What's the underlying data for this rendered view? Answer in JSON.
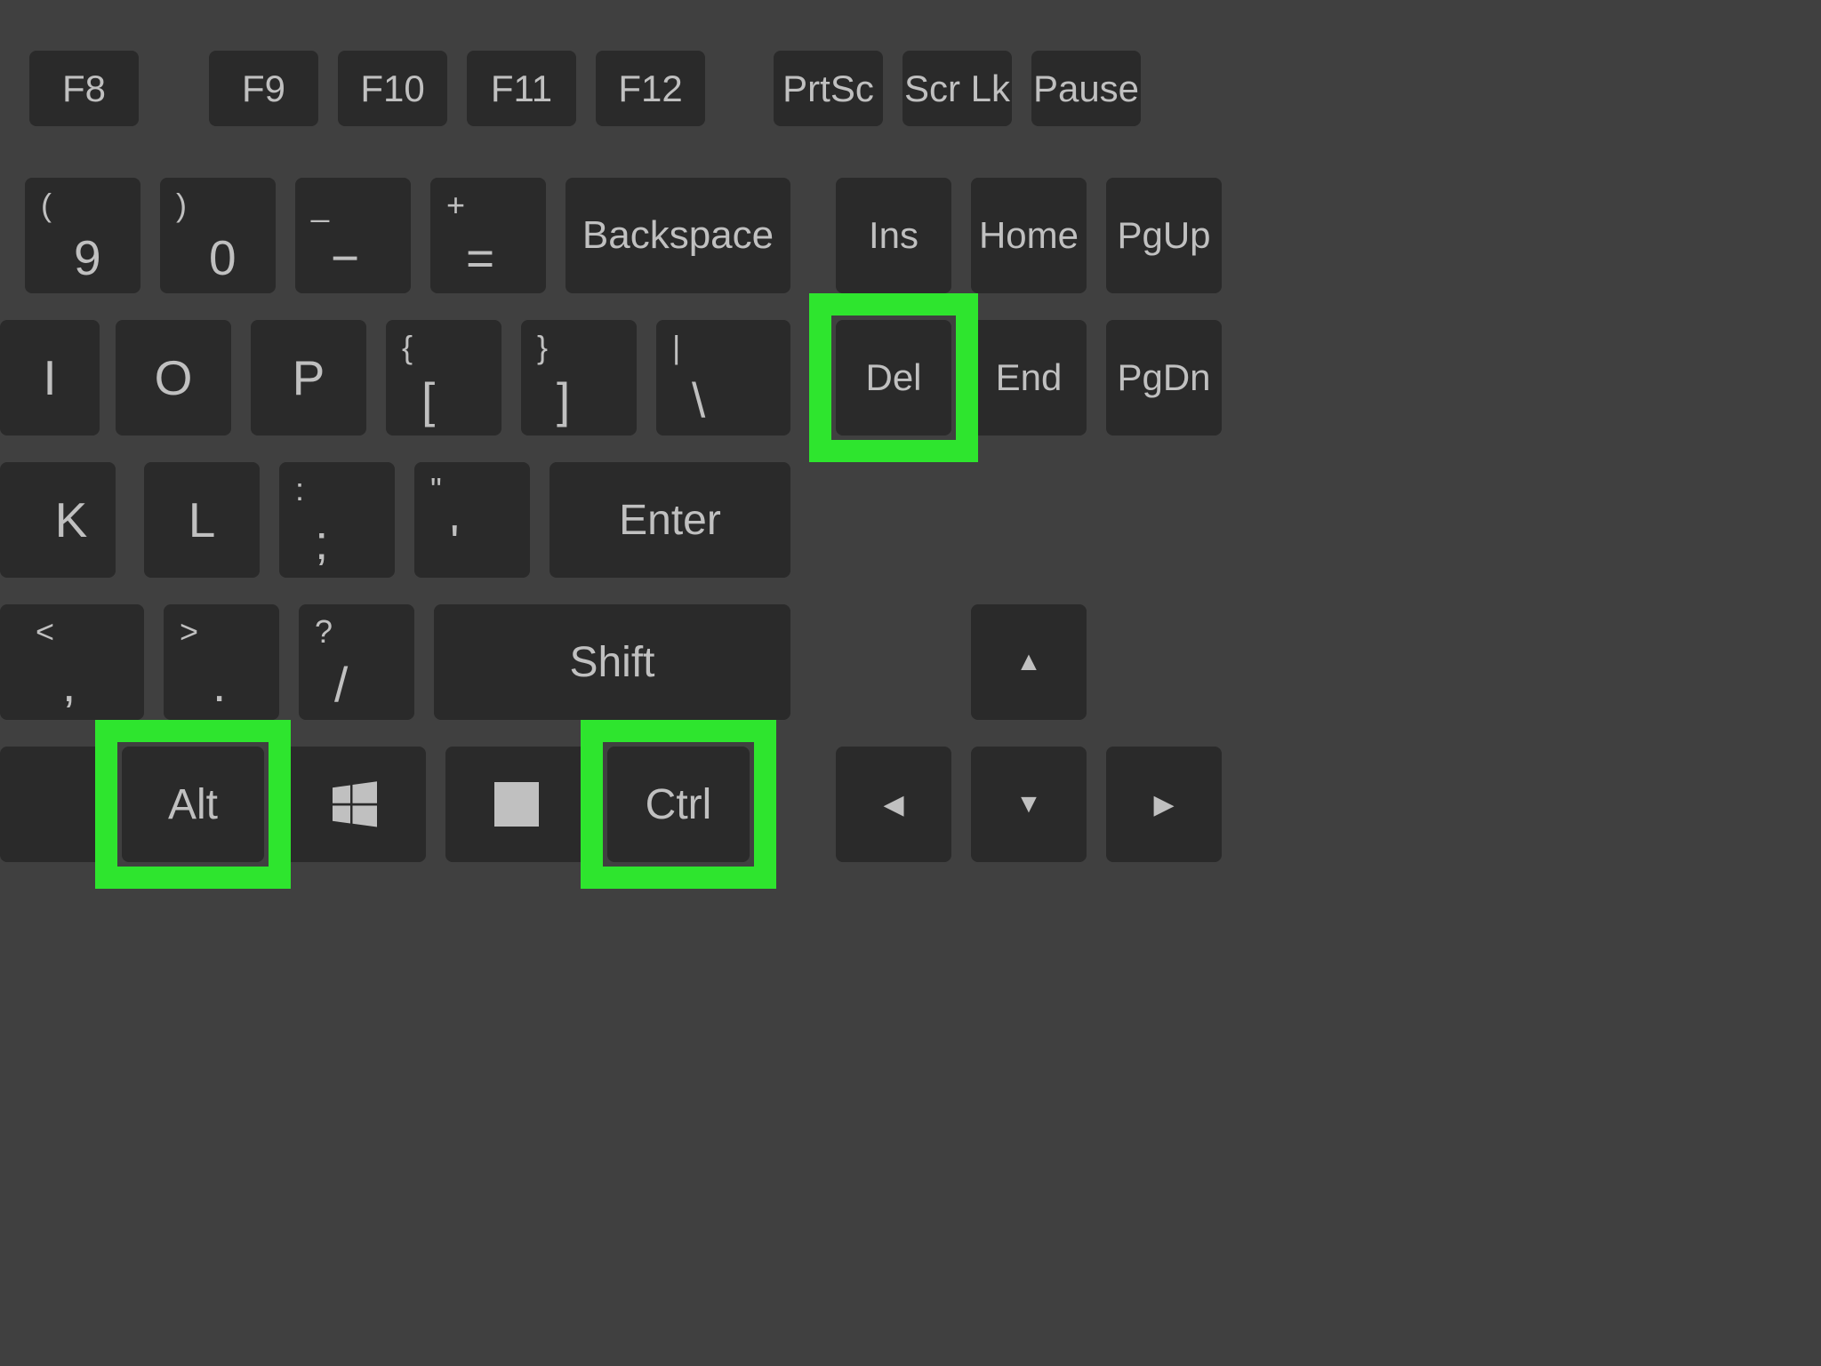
{
  "row1": {
    "f8": "F8",
    "f9": "F9",
    "f10": "F10",
    "f11": "F11",
    "f12": "F12",
    "prtsc": "PrtSc",
    "scrlk": "Scr Lk",
    "pause": "Pause"
  },
  "row2": {
    "nine_upper": "(",
    "nine_lower": "9",
    "zero_upper": ")",
    "zero_lower": "0",
    "minus_upper": "_",
    "minus_lower": "−",
    "equals_upper": "+",
    "equals_lower": "=",
    "backspace": "Backspace",
    "ins": "Ins",
    "home": "Home",
    "pgup": "PgUp"
  },
  "row3": {
    "i": "I",
    "o": "O",
    "p": "P",
    "lbracket_upper": "{",
    "lbracket_lower": "[",
    "rbracket_upper": "}",
    "rbracket_lower": "]",
    "backslash_upper": "|",
    "backslash_lower": "\\",
    "del": "Del",
    "end": "End",
    "pgdn": "PgDn"
  },
  "row4": {
    "k": "K",
    "l": "L",
    "semicolon_upper": ":",
    "semicolon_lower": ";",
    "quote_upper": "\"",
    "quote_lower": "'",
    "enter": "Enter"
  },
  "row5": {
    "comma_upper": "<",
    "comma_lower": ",",
    "period_upper": ">",
    "period_lower": ".",
    "slash_upper": "?",
    "slash_lower": "/",
    "shift": "Shift",
    "up": "▲"
  },
  "row6": {
    "alt": "Alt",
    "ctrl": "Ctrl",
    "left": "◀",
    "down": "▼",
    "right": "▶"
  },
  "highlight_color": "#2ee52e",
  "highlighted_keys": [
    "Del",
    "Alt",
    "Ctrl"
  ]
}
